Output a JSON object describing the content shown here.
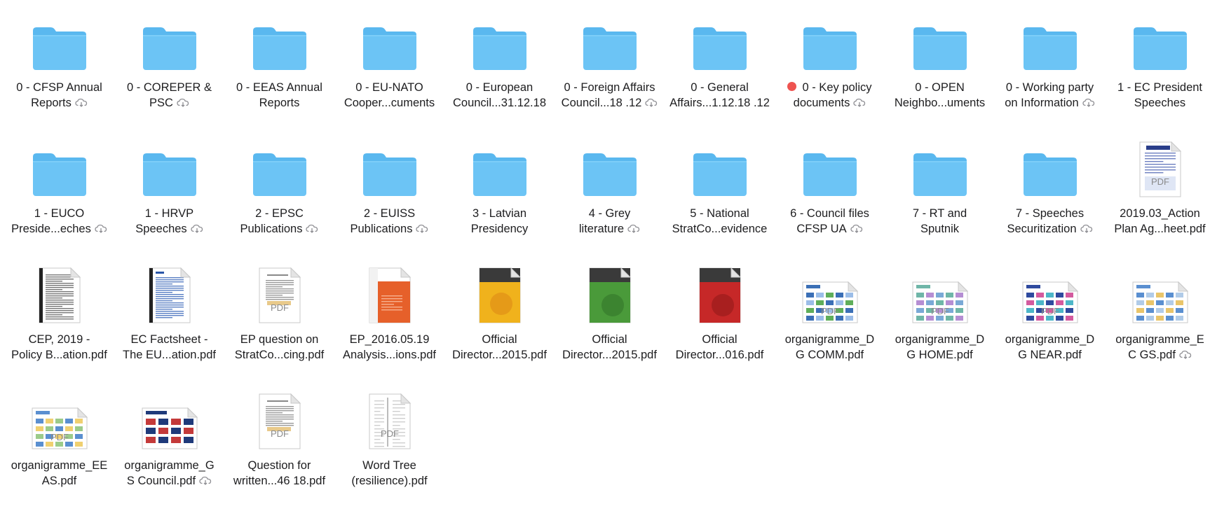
{
  "colors": {
    "folder": "#6cc4f5",
    "folder_tab": "#5ab8ef",
    "label_text": "#1d1d1f",
    "tag_red": "#ee5350",
    "cloud": "#8e8e93"
  },
  "pdf_badge": "PDF",
  "items": [
    {
      "id": "cfsp-annual-reports",
      "type": "folder",
      "lines": [
        "0 - CFSP Annual",
        "Reports"
      ],
      "cloud": true
    },
    {
      "id": "coreper-psc",
      "type": "folder",
      "lines": [
        "0 - COREPER &",
        "PSC"
      ],
      "cloud": true
    },
    {
      "id": "eeas-annual-reports",
      "type": "folder",
      "lines": [
        "0 - EEAS Annual",
        "Reports"
      ],
      "cloud": false
    },
    {
      "id": "eu-nato",
      "type": "folder",
      "lines": [
        "0 - EU-NATO",
        "Cooper...cuments"
      ],
      "cloud": false
    },
    {
      "id": "european-council",
      "type": "folder",
      "lines": [
        "0 - European",
        "Council...31.12.18"
      ],
      "cloud": false
    },
    {
      "id": "foreign-affairs-council",
      "type": "folder",
      "lines": [
        "0 - Foreign Affairs",
        "Council...18 .12"
      ],
      "cloud": true
    },
    {
      "id": "general-affairs",
      "type": "folder",
      "lines": [
        "0 - General",
        "Affairs...1.12.18 .12"
      ],
      "cloud": false
    },
    {
      "id": "key-policy-documents",
      "type": "folder",
      "lines": [
        "0 - Key policy",
        "documents"
      ],
      "cloud": true,
      "tag": "red"
    },
    {
      "id": "open-neighbourhood",
      "type": "folder",
      "lines": [
        "0 - OPEN",
        "Neighbo...uments"
      ],
      "cloud": false
    },
    {
      "id": "working-party-information",
      "type": "folder",
      "lines": [
        "0 - Working party",
        "on Information"
      ],
      "cloud": true
    },
    {
      "id": "ec-president-speeches",
      "type": "folder",
      "lines": [
        "1 - EC President",
        "Speeches"
      ],
      "cloud": false
    },
    {
      "id": "euco-president-speeches",
      "type": "folder",
      "lines": [
        "1 - EUCO",
        "Preside...eches"
      ],
      "cloud": true
    },
    {
      "id": "hrvp-speeches",
      "type": "folder",
      "lines": [
        "1 - HRVP",
        "Speeches"
      ],
      "cloud": true
    },
    {
      "id": "epsc-publications",
      "type": "folder",
      "lines": [
        "2 - EPSC",
        "Publications"
      ],
      "cloud": true
    },
    {
      "id": "euiss-publications",
      "type": "folder",
      "lines": [
        "2 - EUISS",
        "Publications"
      ],
      "cloud": true
    },
    {
      "id": "latvian-presidency",
      "type": "folder",
      "lines": [
        "3 - Latvian",
        "Presidency"
      ],
      "cloud": false
    },
    {
      "id": "grey-literature",
      "type": "folder",
      "lines": [
        "4 - Grey",
        "literature"
      ],
      "cloud": true
    },
    {
      "id": "national-stratcom-evidence",
      "type": "folder",
      "lines": [
        "5 - National",
        "StratCo...evidence"
      ],
      "cloud": false
    },
    {
      "id": "council-files-cfsp-ua",
      "type": "folder",
      "lines": [
        "6 - Council files",
        "CFSP UA"
      ],
      "cloud": true
    },
    {
      "id": "rt-and-sputnik",
      "type": "folder",
      "lines": [
        "7 - RT and",
        "Sputnik"
      ],
      "cloud": false
    },
    {
      "id": "speeches-securitization",
      "type": "folder",
      "lines": [
        "7 - Speeches",
        "Securitization"
      ],
      "cloud": true
    },
    {
      "id": "action-plan-factsheet",
      "type": "pdf",
      "thumb": "doc-infographic",
      "lines": [
        "2019.03_Action",
        "Plan Ag...heet.pdf"
      ],
      "cloud": false,
      "badge": true
    },
    {
      "id": "cep-policy-brief",
      "type": "pdf",
      "thumb": "doc-text-dark",
      "lines": [
        "CEP, 2019 -",
        "Policy B...ation.pdf"
      ],
      "cloud": false
    },
    {
      "id": "ec-factsheet",
      "type": "pdf",
      "thumb": "doc-text-blue",
      "lines": [
        "EC Factsheet -",
        "The EU...ation.pdf"
      ],
      "cloud": false
    },
    {
      "id": "ep-question-stratcom",
      "type": "pdf",
      "thumb": "doc-text-plain",
      "lines": [
        "EP question on",
        "StratCo...cing.pdf"
      ],
      "cloud": false,
      "badge": true
    },
    {
      "id": "ep-analysis",
      "type": "pdf",
      "thumb": "doc-orange",
      "lines": [
        "EP_2016.05.19",
        "Analysis...ions.pdf"
      ],
      "cloud": false
    },
    {
      "id": "official-directory-yellow",
      "type": "pdf",
      "thumb": "doc-yellow",
      "lines": [
        "Official",
        "Director...2015.pdf"
      ],
      "cloud": false
    },
    {
      "id": "official-directory-green",
      "type": "pdf",
      "thumb": "doc-green",
      "lines": [
        "Official",
        "Director...2015.pdf"
      ],
      "cloud": false
    },
    {
      "id": "official-directory-red",
      "type": "pdf",
      "thumb": "doc-red",
      "lines": [
        "Official",
        "Director...016.pdf"
      ],
      "cloud": false
    },
    {
      "id": "organigramme-dg-comm",
      "type": "pdf",
      "thumb": "land-chart-a",
      "lines": [
        "organigramme_D",
        "G COMM.pdf"
      ],
      "cloud": false,
      "badge": true
    },
    {
      "id": "organigramme-dg-home",
      "type": "pdf",
      "thumb": "land-chart-b",
      "lines": [
        "organigramme_D",
        "G HOME.pdf"
      ],
      "cloud": false,
      "badge": true
    },
    {
      "id": "organigramme-dg-near",
      "type": "pdf",
      "thumb": "land-chart-c",
      "lines": [
        "organigramme_D",
        "G NEAR.pdf"
      ],
      "cloud": false,
      "badge": true
    },
    {
      "id": "organigramme-ec-gs",
      "type": "pdf",
      "thumb": "land-chart-d",
      "lines": [
        "organigramme_E",
        "C GS.pdf"
      ],
      "cloud": true
    },
    {
      "id": "organigramme-eeas",
      "type": "pdf",
      "thumb": "land-chart-e",
      "lines": [
        "organigramme_EE",
        "AS.pdf"
      ],
      "cloud": false,
      "badge": true
    },
    {
      "id": "organigramme-gs-council",
      "type": "pdf",
      "thumb": "land-dark",
      "lines": [
        "organigramme_G",
        "S Council.pdf"
      ],
      "cloud": true
    },
    {
      "id": "question-for-written",
      "type": "pdf",
      "thumb": "doc-text-plain",
      "lines": [
        "Question for",
        "written...46 18.pdf"
      ],
      "cloud": false,
      "badge": true
    },
    {
      "id": "word-tree-resilience",
      "type": "pdf",
      "thumb": "doc-wordtree",
      "lines": [
        "Word Tree",
        "(resilience).pdf"
      ],
      "cloud": false,
      "badge": true
    }
  ]
}
